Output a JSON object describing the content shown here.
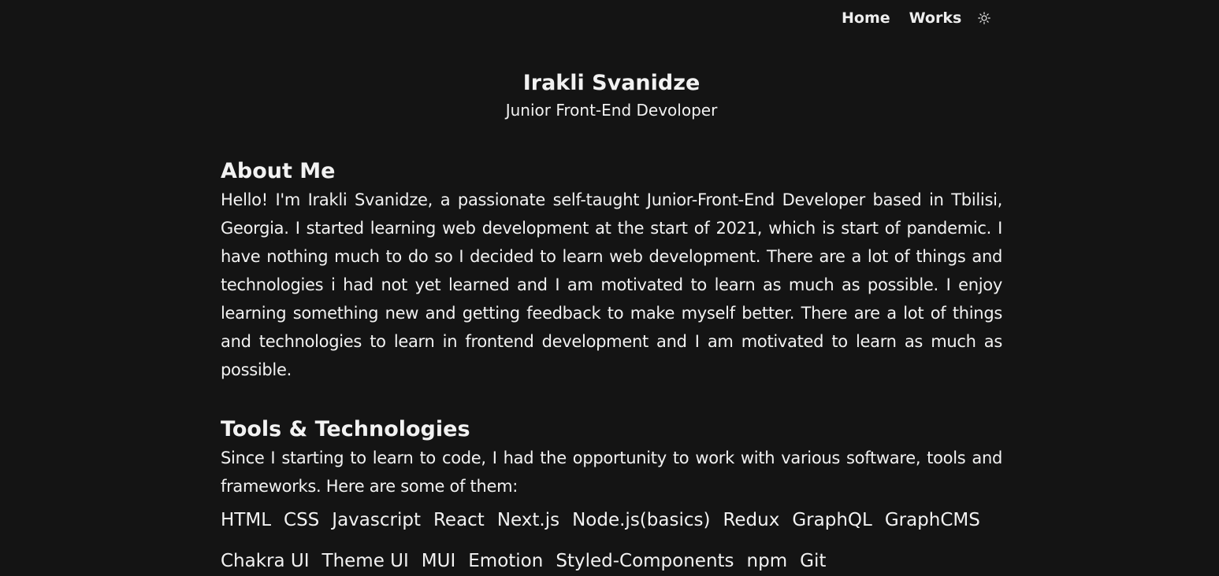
{
  "nav": {
    "home": "Home",
    "works": "Works",
    "theme_icon": "sun-icon"
  },
  "hero": {
    "name": "Irakli Svanidze",
    "title": "Junior Front-End Devoloper"
  },
  "about": {
    "heading": "About Me",
    "text": "Hello! I'm Irakli Svanidze, a passionate self-taught Junior-Front-End Developer based in Tbilisi, Georgia. I started learning web development at the start of 2021, which is start of pandemic. I have nothing much to do so I decided to learn web development. There are a lot of things and technologies i had not yet learned and I am motivated to learn as much as possible. I enjoy learning something new and getting feedback to make myself better. There are a lot of things and technologies to learn in frontend development and I am motivated to learn as much as possible."
  },
  "tools": {
    "heading": "Tools & Technologies",
    "text": "Since I starting to learn to code, I had the opportunity to work with various software, tools and frameworks. Here are some of them:",
    "items": [
      "HTML",
      "CSS",
      "Javascript",
      "React",
      "Next.js",
      "Node.js(basics)",
      "Redux",
      "GraphQL",
      "GraphCMS",
      "Chakra UI",
      "Theme UI",
      "MUI",
      "Emotion",
      "Styled-Components",
      "npm",
      "Git"
    ]
  },
  "colors": {
    "background": "#141414",
    "text": "#f2f2f2"
  }
}
